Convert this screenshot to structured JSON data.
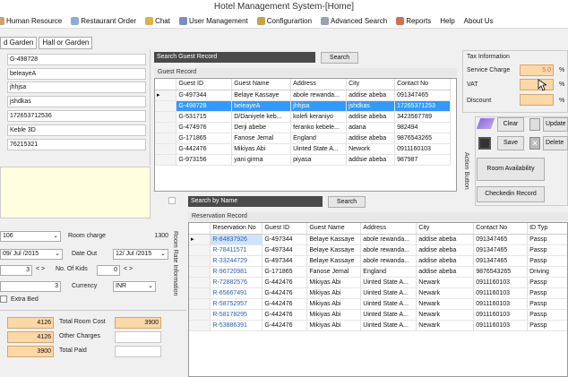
{
  "window": {
    "title": "Hotel Management System-[Home]"
  },
  "menu": [
    {
      "label": "Human Resource",
      "icon": "people-icon"
    },
    {
      "label": "Restaurant Order",
      "icon": "edit-icon"
    },
    {
      "label": "Chat",
      "icon": "chat-icon"
    },
    {
      "label": "User Management",
      "icon": "users-icon"
    },
    {
      "label": "Configurartion",
      "icon": "config-icon"
    },
    {
      "label": "Advanced Search",
      "icon": "binoculars-icon"
    },
    {
      "label": "Reports",
      "icon": "report-icon"
    },
    {
      "label": "Help",
      "icon": ""
    },
    {
      "label": "About Us",
      "icon": ""
    }
  ],
  "tabs": [
    {
      "label": "d Garden"
    },
    {
      "label": "Hall or Garden"
    }
  ],
  "left_fields": [
    "G-498728",
    "beleayeA",
    "jhhjsa",
    "jshdkas",
    "172653712536",
    "Keble 3D",
    "76215321"
  ],
  "room": {
    "room_no": "106",
    "room_charge_label": "Room charge",
    "room_charge": "1300",
    "date_in": "09/ Jul /2015",
    "date_out_label": "Date Out",
    "date_out": "12/ Jul /2015",
    "adults": "3",
    "kids_label": "No. Of Kids",
    "kids": "0",
    "nights": "3",
    "currency_label": "Currency",
    "currency": "INR",
    "extra_bed": "Extra Bed",
    "side_label": "Room Rate Information"
  },
  "costs": {
    "total": "4126",
    "total_room_cost_label": "Total Room Cost",
    "total_room_cost": "3900",
    "other_val": "4126",
    "other_charges_label": "Other Charges",
    "other_charges": "",
    "paid_val": "3900",
    "total_paid_label": "Total Paid",
    "total_paid": ""
  },
  "guest_search": {
    "placeholder": "Search Guest Record",
    "search_label": "Search",
    "header": "Guest Record"
  },
  "guest_table": {
    "columns": [
      "Guest ID",
      "Guest Name",
      "Address",
      "City",
      "Contact No"
    ],
    "rows": [
      [
        "G-497344",
        "Belaye Kassaye",
        "abole rewanda...",
        "addise abeba",
        "091347465"
      ],
      [
        "G-498728",
        "beleayeA",
        "jhhjsa",
        "jshdkas",
        "17265371253"
      ],
      [
        "G-531715",
        "D/Daniyele keb...",
        "kolefi keraniyo",
        "addise abeba",
        "3423567789"
      ],
      [
        "G-474976",
        "Derji abebe",
        "feranko kebele...",
        "adana",
        "982494"
      ],
      [
        "G-171865",
        "Fanose Jemal",
        "England",
        "addise abeba",
        "9876543265"
      ],
      [
        "G-442476",
        "Mikiyas Abi",
        "Uinted State A...",
        "Nework",
        "0911160103"
      ],
      [
        "G-973156",
        "yani girma",
        "piyasa",
        "addsie abeba",
        "987987"
      ]
    ],
    "selected_row": 1
  },
  "tax": {
    "header": "Tax Information",
    "service_charge_label": "Service Charge",
    "service_charge": "5.0",
    "pct1": "%",
    "vat_label": "VAT",
    "vat": "",
    "pct2": "%",
    "discount_label": "Discount",
    "discount": "",
    "pct3": "%"
  },
  "actions": {
    "side_label": "Action Button",
    "clear": "Clear",
    "update": "Update",
    "save": "Save",
    "delete": "Delete",
    "room_availability": "Room Availability",
    "checkedin_record": "Checkedin Record"
  },
  "name_search": {
    "placeholder": "Search by Name",
    "search_label": "Search",
    "header": "Reservation Record"
  },
  "res_table": {
    "columns": [
      "Reservation No",
      "Guest ID",
      "Guest Name",
      "Address",
      "City",
      "Contact No",
      "ID Typ"
    ],
    "rows": [
      [
        "R-84837926",
        "G-497344",
        "Belaye Kassaye",
        "abole rewanda...",
        "addise abeba",
        "091347465",
        "Passp"
      ],
      [
        "R-78411571",
        "G-497344",
        "Belaye Kassaye",
        "abole rewanda...",
        "addise abeba",
        "091347465",
        "Passp"
      ],
      [
        "R-33244729",
        "G-497344",
        "Belaye Kassaye",
        "abole rewanda...",
        "addise abeba",
        "091347465",
        "Passp"
      ],
      [
        "R-96720981",
        "G-171865",
        "Fanose Jemal",
        "England",
        "addise abeba",
        "9876543265",
        "Driving"
      ],
      [
        "R-72882576",
        "G-442476",
        "Mikiyas Abi",
        "Uinted State A...",
        "Newark",
        "0911160103",
        "Passp"
      ],
      [
        "R-65667491",
        "G-442476",
        "Mikiyas Abi",
        "Uinted State A...",
        "Newark",
        "0911160103",
        "Passp"
      ],
      [
        "R-58752957",
        "G-442476",
        "Mikiyas Abi",
        "Uinted State A...",
        "Newark",
        "0911160103",
        "Passp"
      ],
      [
        "R-58178295",
        "G-442476",
        "Mikiyas Abi",
        "Uinted State A...",
        "Newark",
        "0911160103",
        "Passp"
      ],
      [
        "R-53886391",
        "G-442476",
        "Mikiyas Abi",
        "Uinted State A...",
        "Newark",
        "0911160103",
        "Passp"
      ]
    ]
  }
}
